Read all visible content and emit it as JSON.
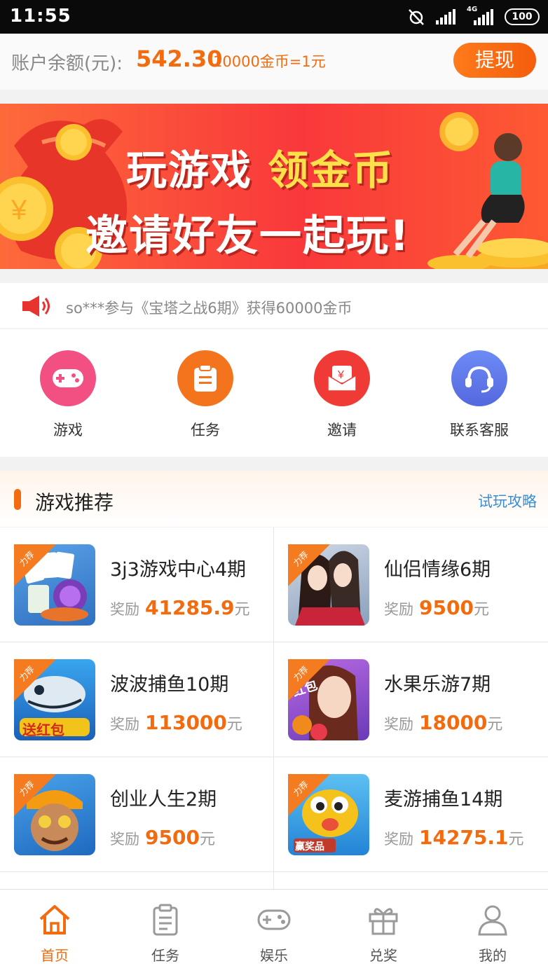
{
  "status_bar": {
    "time": "11:55",
    "network": "4G",
    "battery": "100"
  },
  "account": {
    "balance_label": "账户余额(元):",
    "balance": "542.30",
    "rate": "10000金币=1元",
    "withdraw_label": "提现"
  },
  "banner": {
    "line1_white": "玩游戏",
    "line1_gold": "领金币",
    "line2": "邀请好友一起玩!"
  },
  "notice": {
    "text": "so***参与《宝塔之战6期》获得60000金币"
  },
  "quick_menu": [
    {
      "label": "游戏",
      "icon": "gamepad-icon",
      "color": "#f24f82"
    },
    {
      "label": "任务",
      "icon": "task-clipboard-icon",
      "color": "#f4731d"
    },
    {
      "label": "邀请",
      "icon": "invite-envelope-icon",
      "color": "#f03a35"
    },
    {
      "label": "联系客服",
      "icon": "headset-icon",
      "color": "#5f7bea"
    }
  ],
  "recommend": {
    "title": "游戏推荐",
    "link": "试玩攻略"
  },
  "games": [
    {
      "badge": "力荐",
      "title": "3j3游戏中心4期",
      "reward_label": "奖励",
      "amount": "41285.9",
      "unit": "元"
    },
    {
      "badge": "力荐",
      "title": "仙侣情缘6期",
      "reward_label": "奖励",
      "amount": "9500",
      "unit": "元"
    },
    {
      "badge": "力荐",
      "title": "波波捕鱼10期",
      "reward_label": "奖励",
      "amount": "113000",
      "unit": "元"
    },
    {
      "badge": "力荐",
      "title": "水果乐游7期",
      "reward_label": "奖励",
      "amount": "18000",
      "unit": "元"
    },
    {
      "badge": "力荐",
      "title": "创业人生2期",
      "reward_label": "奖励",
      "amount": "9500",
      "unit": "元"
    },
    {
      "badge": "力荐",
      "title": "麦游捕鱼14期",
      "reward_label": "奖励",
      "amount": "14275.1",
      "unit": "元"
    }
  ],
  "thumb_text": {
    "game3": "送红包",
    "game4": "红包",
    "game6": "赢奖品"
  },
  "bottom_nav": [
    {
      "label": "首页",
      "icon": "home-icon",
      "active": true
    },
    {
      "label": "任务",
      "icon": "task-icon",
      "active": false
    },
    {
      "label": "娱乐",
      "icon": "gamepad-icon",
      "active": false
    },
    {
      "label": "兑奖",
      "icon": "gift-icon",
      "active": false
    },
    {
      "label": "我的",
      "icon": "user-icon",
      "active": false
    }
  ]
}
